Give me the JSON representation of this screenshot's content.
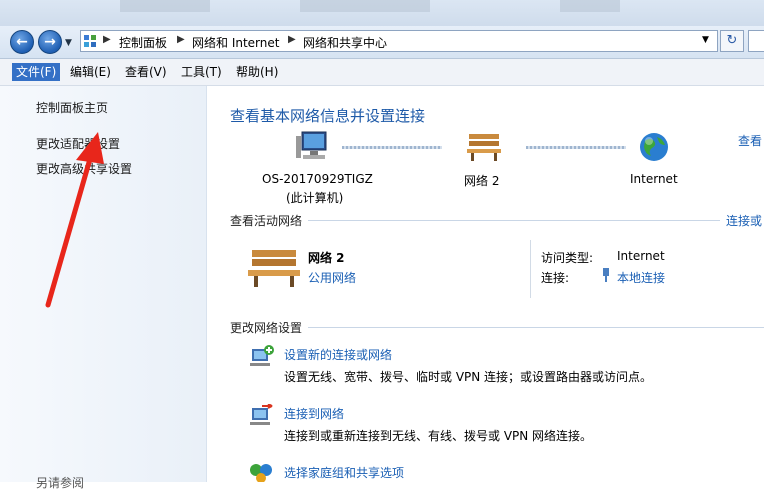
{
  "breadcrumb": {
    "items": [
      "控制面板",
      "网络和 Internet",
      "网络和共享中心"
    ]
  },
  "menu": {
    "items": [
      "文件(F)",
      "编辑(E)",
      "查看(V)",
      "工具(T)",
      "帮助(H)"
    ]
  },
  "sidebar": {
    "home": "控制面板主页",
    "adapter": "更改适配器设置",
    "sharing": "更改高级共享设置",
    "bottom_partial": "另请参阅"
  },
  "main": {
    "title": "查看基本网络信息并设置连接",
    "view_full_map": "查看",
    "map": {
      "computer_name": "OS-20170929TIGZ",
      "computer_sub": "(此计算机)",
      "network_name": "网络  2",
      "internet": "Internet"
    },
    "active_networks": {
      "header": "查看活动网络",
      "right_link": "连接或",
      "network_name": "网络  2",
      "network_type": "公用网络",
      "access_type_label": "访问类型:",
      "access_type_value": "Internet",
      "connection_label": "连接:",
      "connection_value": "本地连接"
    },
    "change_settings": {
      "header": "更改网络设置",
      "items": [
        {
          "title": "设置新的连接或网络",
          "desc": "设置无线、宽带、拨号、临时或 VPN 连接；或设置路由器或访问点。"
        },
        {
          "title": "连接到网络",
          "desc": "连接到或重新连接到无线、有线、拨号或 VPN 网络连接。"
        },
        {
          "title": "选择家庭组和共享选项",
          "desc": ""
        }
      ]
    }
  },
  "colors": {
    "link": "#1a5fb4",
    "title": "#1e5aa8",
    "annotation_arrow": "#e8261b",
    "menu_active": "#3470c6"
  }
}
